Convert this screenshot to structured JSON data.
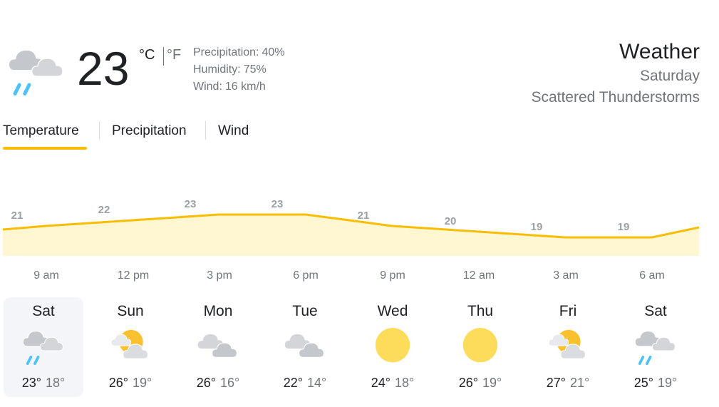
{
  "current": {
    "icon": "thunderstorm-icon",
    "temperature": "23",
    "unit_celsius": "°C",
    "unit_fahrenheit": "°F",
    "details": [
      {
        "label": "Precipitation:",
        "value": "40%"
      },
      {
        "label": "Humidity:",
        "value": "75%"
      },
      {
        "label": "Wind:",
        "value": "16 km/h"
      }
    ]
  },
  "header": {
    "title": "Weather",
    "day": "Saturday",
    "condition": "Scattered Thunderstorms"
  },
  "tabs": [
    {
      "label": "Temperature",
      "active": true
    },
    {
      "label": "Precipitation",
      "active": false
    },
    {
      "label": "Wind",
      "active": false
    }
  ],
  "chart_data": {
    "type": "area",
    "x": [
      "9 am",
      "12 pm",
      "3 pm",
      "6 pm",
      "9 pm",
      "12 am",
      "3 am",
      "6 am"
    ],
    "values": [
      21,
      22,
      23,
      23,
      21,
      20,
      19,
      19
    ],
    "labels": [
      "21",
      "22",
      "23",
      "23",
      "21",
      "20",
      "19",
      "19"
    ],
    "line_color": "#fbbc04",
    "fill_color": "#fef7d2"
  },
  "forecast": [
    {
      "day": "Sat",
      "icon": "thunderstorm-icon",
      "high": "23°",
      "low": "18°",
      "selected": true
    },
    {
      "day": "Sun",
      "icon": "partly-cloudy-icon",
      "high": "26°",
      "low": "19°",
      "selected": false
    },
    {
      "day": "Mon",
      "icon": "cloudy-icon",
      "high": "26°",
      "low": "16°",
      "selected": false
    },
    {
      "day": "Tue",
      "icon": "cloudy-icon",
      "high": "22°",
      "low": "14°",
      "selected": false
    },
    {
      "day": "Wed",
      "icon": "sunny-icon",
      "high": "24°",
      "low": "18°",
      "selected": false
    },
    {
      "day": "Thu",
      "icon": "sunny-icon",
      "high": "26°",
      "low": "19°",
      "selected": false
    },
    {
      "day": "Fri",
      "icon": "partly-cloudy-icon",
      "high": "27°",
      "low": "21°",
      "selected": false
    },
    {
      "day": "Sat",
      "icon": "thunderstorm-icon",
      "high": "25°",
      "low": "19°",
      "selected": false
    }
  ]
}
